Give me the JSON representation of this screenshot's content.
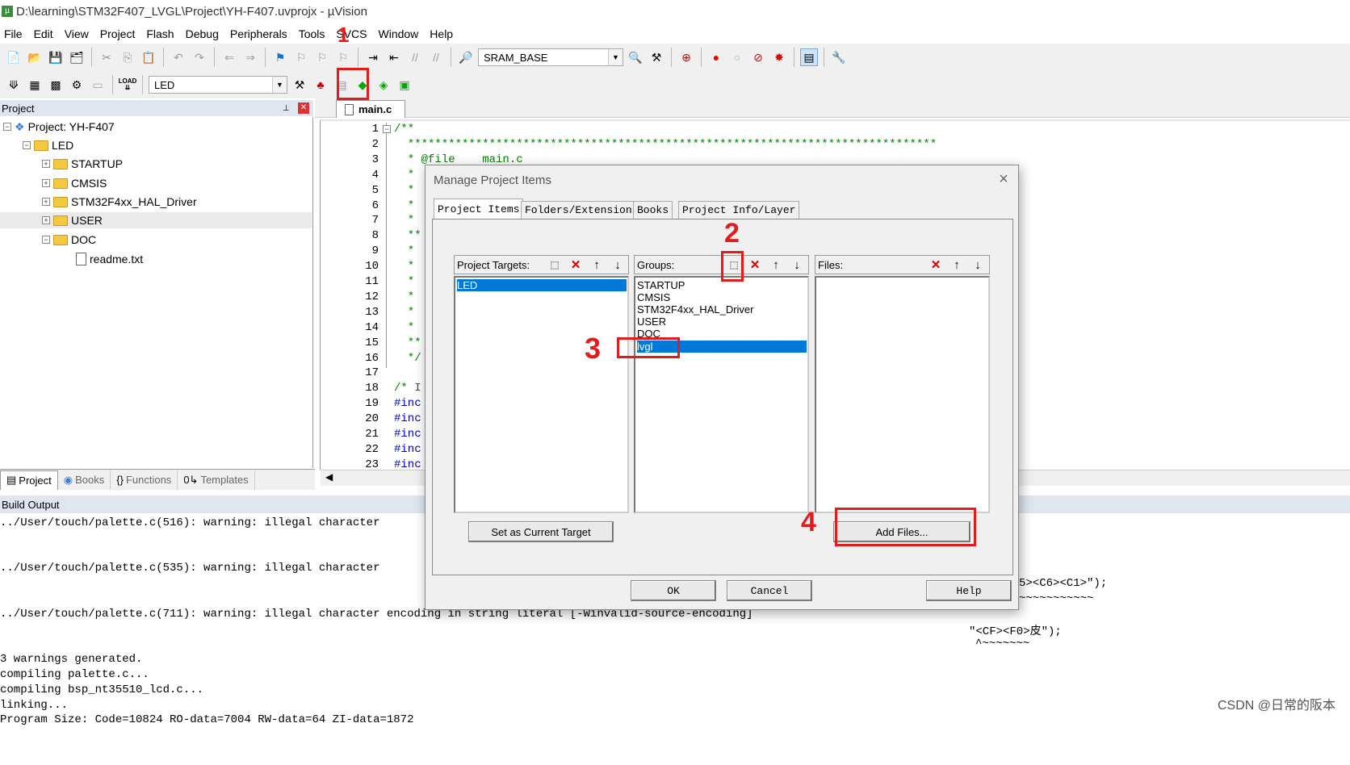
{
  "window": {
    "title": "D:\\learning\\STM32F407_LVGL\\Project\\YH-F407.uvprojx - µVision",
    "app_icon": "µ"
  },
  "menu": [
    "File",
    "Edit",
    "View",
    "Project",
    "Flash",
    "Debug",
    "Peripherals",
    "Tools",
    "SVCS",
    "Window",
    "Help"
  ],
  "toolbar1": {
    "target_combo": "SRAM_BASE"
  },
  "toolbar2": {
    "target_select": "LED",
    "load_label": "LOAD"
  },
  "annotations": {
    "n1": "1",
    "n2": "2",
    "n3": "3",
    "n4": "4"
  },
  "project_panel": {
    "title": "Project",
    "pin": "⊥",
    "close": "✕",
    "root": "Project: YH-F407",
    "target": "LED",
    "groups": [
      "STARTUP",
      "CMSIS",
      "STM32F4xx_HAL_Driver",
      "USER",
      "DOC"
    ],
    "doc_file": "readme.txt"
  },
  "bottom_tabs": [
    "Project",
    "Books",
    "Functions",
    "Templates"
  ],
  "editor": {
    "tab": "main.c",
    "lines": [
      {
        "n": "1",
        "t": "/**"
      },
      {
        "n": "2",
        "t": "  ******************************************************************************"
      },
      {
        "n": "3",
        "t": "  * @file    main.c"
      },
      {
        "n": "4",
        "t": "  *"
      },
      {
        "n": "5",
        "t": "  *"
      },
      {
        "n": "6",
        "t": "  *"
      },
      {
        "n": "7",
        "t": "  *"
      },
      {
        "n": "8",
        "t": "  **"
      },
      {
        "n": "9",
        "t": "  *"
      },
      {
        "n": "10",
        "t": "  *"
      },
      {
        "n": "11",
        "t": "  *"
      },
      {
        "n": "12",
        "t": "  *"
      },
      {
        "n": "13",
        "t": "  *"
      },
      {
        "n": "14",
        "t": "  *"
      },
      {
        "n": "15",
        "t": "  **"
      },
      {
        "n": "16",
        "t": "  */"
      },
      {
        "n": "17",
        "t": ""
      },
      {
        "n": "18",
        "t": "/* I"
      },
      {
        "n": "19",
        "t": "#inc"
      },
      {
        "n": "20",
        "t": "#inc"
      },
      {
        "n": "21",
        "t": "#inc"
      },
      {
        "n": "22",
        "t": "#inc"
      },
      {
        "n": "23",
        "t": "#inc"
      }
    ]
  },
  "build_output": {
    "title": "Build Output",
    "lines": [
      "../User/touch/palette.c(516): warning: illegal character",
      "",
      "",
      "../User/touch/palette.c(535): warning: illegal character",
      "",
      "",
      "../User/touch/palette.c(711): warning: illegal character encoding in string literal [-Winvalid-source-encoding]",
      "",
      "",
      "3 warnings generated.",
      "compiling palette.c...",
      "compiling bsp_nt35510_lcd.c...",
      "linking...",
      "Program Size: Code=10824 RO-data=7004 RW-data=64 ZI-data=1872"
    ],
    "right_fragments": [
      "5><C6><C1>\");",
      "~~~~~~~~~~~",
      "\"<CF><F0>皮\");",
      "^~~~~~~~"
    ]
  },
  "dialog": {
    "title": "Manage Project Items",
    "close": "×",
    "tabs": [
      "Project Items",
      "Folders/Extensions",
      "Books",
      "Project Info/Layer"
    ],
    "targets_label": "Project Targets:",
    "targets": [
      "LED"
    ],
    "groups_label": "Groups:",
    "groups": [
      "STARTUP",
      "CMSIS",
      "STM32F4xx_HAL_Driver",
      "USER",
      "DOC",
      "lvgl"
    ],
    "files_label": "Files:",
    "set_target_btn": "Set as Current Target",
    "add_files_btn": "Add Files...",
    "ok": "OK",
    "cancel": "Cancel",
    "help": "Help"
  },
  "watermark": "CSDN @日常的阪本",
  "colors": {
    "accent_red": "#e31b1b",
    "selection": "#0078d7",
    "code_green": "#008000"
  }
}
